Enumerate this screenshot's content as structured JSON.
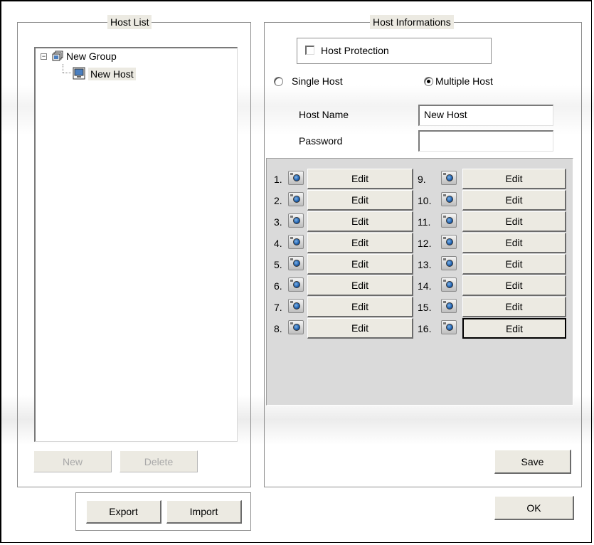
{
  "host_list": {
    "legend": "Host List",
    "tree": {
      "expander": "−",
      "group_label": "New Group",
      "host_label": "New Host"
    },
    "new_button": "New",
    "delete_button": "Delete"
  },
  "export_import": {
    "export_button": "Export",
    "import_button": "Import"
  },
  "host_info": {
    "legend": "Host Informations",
    "protection_label": "Host Protection",
    "protection_checked": false,
    "single_host_label": "Single Host",
    "multiple_host_label": "Multiple Host",
    "selected_mode": "Multiple Host",
    "host_name_label": "Host Name",
    "host_name_value": "New Host",
    "password_label": "Password",
    "password_value": "",
    "cameras_left": [
      {
        "num": "1.",
        "label": "Edit"
      },
      {
        "num": "2.",
        "label": "Edit"
      },
      {
        "num": "3.",
        "label": "Edit"
      },
      {
        "num": "4.",
        "label": "Edit"
      },
      {
        "num": "5.",
        "label": "Edit"
      },
      {
        "num": "6.",
        "label": "Edit"
      },
      {
        "num": "7.",
        "label": "Edit"
      },
      {
        "num": "8.",
        "label": "Edit"
      }
    ],
    "cameras_right": [
      {
        "num": "9.",
        "label": "Edit"
      },
      {
        "num": "10.",
        "label": "Edit"
      },
      {
        "num": "11.",
        "label": "Edit"
      },
      {
        "num": "12.",
        "label": "Edit"
      },
      {
        "num": "13.",
        "label": "Edit"
      },
      {
        "num": "14.",
        "label": "Edit"
      },
      {
        "num": "15.",
        "label": "Edit"
      },
      {
        "num": "16.",
        "label": "Edit"
      }
    ],
    "camera_icon": "camera-icon",
    "save_button": "Save"
  },
  "ok_button": "OK",
  "colors": {
    "button_face": "#eceae2",
    "camera_panel": "#dadada",
    "lens": "#1d5fae"
  }
}
